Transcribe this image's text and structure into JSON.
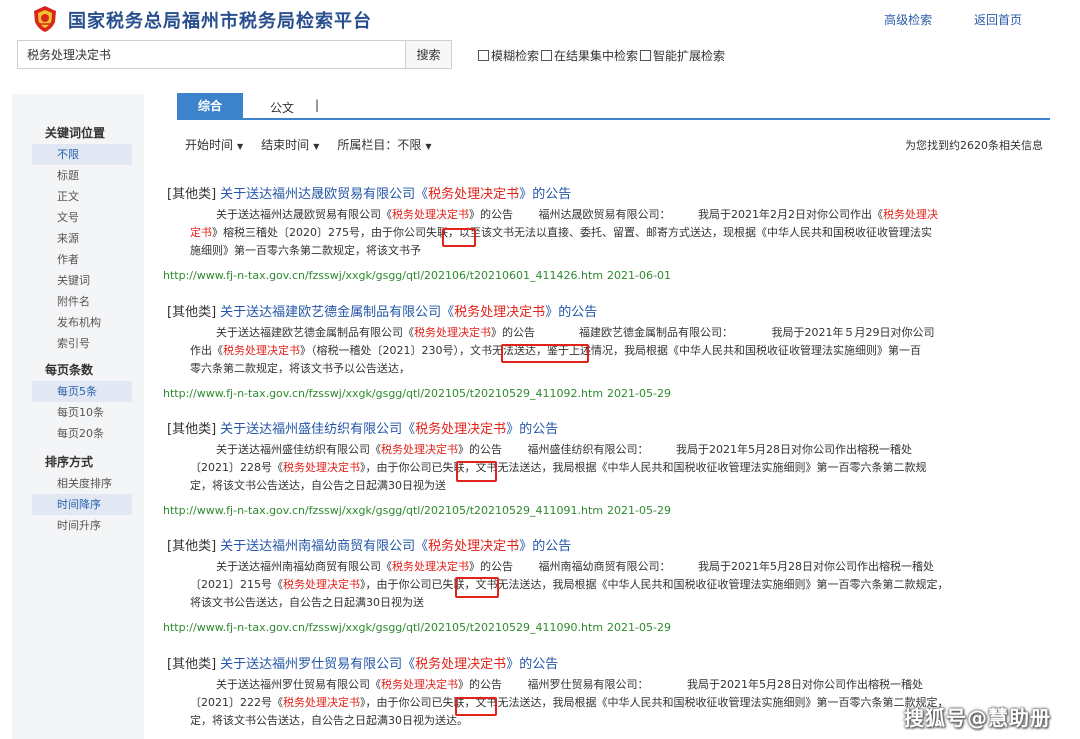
{
  "header": {
    "title": "国家税务总局福州市税务局检索平台",
    "links": [
      "高级检索",
      "返回首页"
    ]
  },
  "search": {
    "value": "税务处理决定书",
    "button_label": "搜索",
    "options": [
      "模糊检索",
      "在结果集中检索",
      "智能扩展检索"
    ]
  },
  "sidebar": {
    "groups": [
      {
        "title": "关键词位置",
        "items": [
          "不限",
          "标题",
          "正文",
          "文号",
          "来源",
          "作者",
          "关键词",
          "附件名",
          "发布机构",
          "索引号"
        ],
        "active": 0
      },
      {
        "title": "每页条数",
        "items": [
          "每页5条",
          "每页10条",
          "每页20条"
        ],
        "active": 0
      },
      {
        "title": "排序方式",
        "items": [
          "相关度排序",
          "时间降序",
          "时间升序"
        ],
        "active": 1
      }
    ]
  },
  "tabs": {
    "items": [
      "综合",
      "公文"
    ],
    "separator": "|",
    "active": 0
  },
  "filters": {
    "items": [
      {
        "label": "开始时间"
      },
      {
        "label": "结束时间"
      },
      {
        "label": "所属栏目：不限"
      }
    ],
    "found_text": "为您找到约2620条相关信息"
  },
  "results": [
    {
      "category": "[其他类]",
      "title_pre": "关于送达福州达晟欧贸易有限公司《",
      "title_hl": "税务处理决定书",
      "title_post": "》的公告",
      "lines": [
        [
          {
            "t": "关于送达福州达晟欧贸易有限公司《"
          },
          {
            "t": "税务处理决定书",
            "hl": true
          },
          {
            "t": "》的公告　　 福州达晟欧贸易有限公司：　　　我局于2021年2月2日对你公司作出《"
          },
          {
            "t": "税务处理决",
            "hl": true
          }
        ],
        [
          {
            "t": "定书",
            "hl": true
          },
          {
            "t": "》榕税三稽处〔2020〕275号，由于你公司失联，以至该文书无法以直接、委托、留置、邮寄方式送达，现根据《中华人民共和国税收征收管理法实"
          }
        ],
        [
          {
            "t": "施细则》第一百零六条第二款规定，将该文书予"
          }
        ]
      ],
      "url": "http://www.fj-n-tax.gov.cn/fzsswj/xxgk/gsgg/qtl/202106/t20210601_411426.htm",
      "date": "2021-06-01"
    },
    {
      "category": "[其他类]",
      "title_pre": "关于送达福建欧艺德金属制品有限公司《",
      "title_hl": "税务处理决定书",
      "title_post": "》的公告",
      "lines": [
        [
          {
            "t": "关于送达福建欧艺德金属制品有限公司《"
          },
          {
            "t": "税务处理决定书",
            "hl": true
          },
          {
            "t": "》的公告　　　　福建欧艺德金属制品有限公司：　　　　我局于2021年５月29日对你公司"
          }
        ],
        [
          {
            "t": "作出《"
          },
          {
            "t": "税务处理决定书",
            "hl": true
          },
          {
            "t": "》（榕税一稽处〔2021〕230号），文书无法送达，鉴于上述情况，我局根据《中华人民共和国税收征收管理法实施细则》第一百"
          }
        ],
        [
          {
            "t": "零六条第二款规定，将该文书予以公告送达，"
          }
        ]
      ],
      "url": "http://www.fj-n-tax.gov.cn/fzsswj/xxgk/gsgg/qtl/202105/t20210529_411092.htm",
      "date": "2021-05-29"
    },
    {
      "category": "[其他类]",
      "title_pre": "关于送达福州盛佳纺织有限公司《",
      "title_hl": "税务处理决定书",
      "title_post": "》的公告",
      "lines": [
        [
          {
            "t": "关于送达福州盛佳纺织有限公司《"
          },
          {
            "t": "税务处理决定书",
            "hl": true
          },
          {
            "t": "》的公告　　 福州盛佳纺织有限公司：　　　我局于2021年5月28日对你公司作出榕税一稽处"
          }
        ],
        [
          {
            "t": "〔2021〕228号《"
          },
          {
            "t": "税务处理决定书",
            "hl": true
          },
          {
            "t": "》，由于你公司已失联，文书无法送达，我局根据《中华人民共和国税收征收管理法实施细则》第一百零六条第二款规"
          }
        ],
        [
          {
            "t": "定，将该文书公告送达，自公告之日起满30日视为送"
          }
        ]
      ],
      "url": "http://www.fj-n-tax.gov.cn/fzsswj/xxgk/gsgg/qtl/202105/t20210529_411091.htm",
      "date": "2021-05-29"
    },
    {
      "category": "[其他类]",
      "title_pre": "关于送达福州南福幼商贸有限公司《",
      "title_hl": "税务处理决定书",
      "title_post": "》的公告",
      "lines": [
        [
          {
            "t": "关于送达福州南福幼商贸有限公司《"
          },
          {
            "t": "税务处理决定书",
            "hl": true
          },
          {
            "t": "》的公告　　 福州南福幼商贸有限公司：　　　我局于2021年5月28日对你公司作出榕税一稽处"
          }
        ],
        [
          {
            "t": "〔2021〕215号《"
          },
          {
            "t": "税务处理决定书",
            "hl": true
          },
          {
            "t": "》，由于你公司已失联，文书无法送达，我局根据《中华人民共和国税收征收管理法实施细则》第一百零六条第二款规定，"
          }
        ],
        [
          {
            "t": "将该文书公告送达，自公告之日起满30日视为送"
          }
        ]
      ],
      "url": "http://www.fj-n-tax.gov.cn/fzsswj/xxgk/gsgg/qtl/202105/t20210529_411090.htm",
      "date": "2021-05-29"
    },
    {
      "category": "[其他类]",
      "title_pre": "关于送达福州罗仕贸易有限公司《",
      "title_hl": "税务处理决定书",
      "title_post": "》的公告",
      "lines": [
        [
          {
            "t": "关于送达福州罗仕贸易有限公司《"
          },
          {
            "t": "税务处理决定书",
            "hl": true
          },
          {
            "t": "》的公告　　 福州罗仕贸易有限公司：　　　　我局于2021年5月28日对你公司作出榕税一稽处"
          }
        ],
        [
          {
            "t": "〔2021〕222号《"
          },
          {
            "t": "税务处理决定书",
            "hl": true
          },
          {
            "t": "》，由于你公司已失联，文书无法送达，我局根据《中华人民共和国税收征收管理法实施细则》第一百零六条第二款规定，"
          }
        ],
        [
          {
            "t": "定，将该文书公告送达，自公告之日起满30日视为送达。"
          }
        ]
      ]
    }
  ],
  "watermark": "搜狐号@慧助册"
}
